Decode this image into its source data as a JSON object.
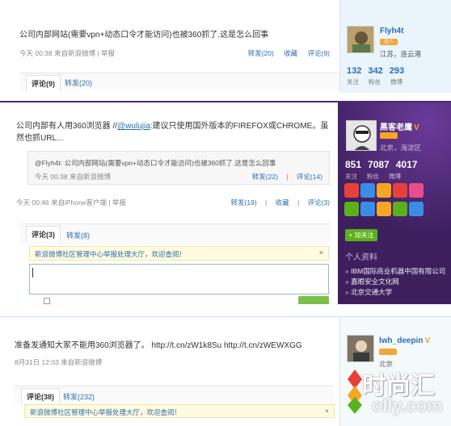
{
  "post1": {
    "text": "公司内部网站(需要vpn+动态口令才能访问)也被360抓了.这是怎么回事",
    "meta_left": "今天 00:38 来自新浪微博 | 举报",
    "actions": [
      "转发(20)",
      "收藏",
      "评论(9)"
    ],
    "tabs": [
      "评论(9)",
      "转发(20)"
    ],
    "user": {
      "name": "Flyh4t",
      "level": "达人",
      "location": "江苏，连云港",
      "stats": [
        "132",
        "342",
        "293"
      ],
      "stat_labels": [
        "关注",
        "粉丝",
        "微博"
      ]
    }
  },
  "post2": {
    "text_before": "公司内部有人用360浏览器 //",
    "mention": "@wulujia",
    "text_after": ":建议只使用国外版本的FIREFOX或CHROME。虽然也抓URL...",
    "quote": {
      "text": "@Flyh4t:  公司内部网站(需要vpn+动态口令才能访问)也被360抓了.这是怎么回事",
      "meta_left": "今天 00:38    来自新浪微博",
      "actions": [
        "转发(22)",
        "|",
        "评论(14)"
      ]
    },
    "meta_left": "今天 00:46 来自iPhone客户端 | 举报",
    "actions": [
      "转发(19)",
      "|",
      "收藏",
      "|",
      "评论(3)"
    ],
    "tabs": [
      "评论(3)",
      "转发(8)"
    ],
    "notice": "新浪微博社区管理中心举报处理大厅，欢迎查阅！",
    "close": "×",
    "user": {
      "name": "黑客老鹰",
      "verified": "V",
      "location": "北京，海淀区",
      "stats": [
        "851",
        "7087",
        "4017"
      ],
      "stat_labels": [
        "关注",
        "粉丝",
        "微博"
      ]
    },
    "follow_button": "+ 加关注",
    "side_heading": "个人资料",
    "side_list": [
      "IBM国际商业机器中国有限公司",
      "嘉眼安全文化网",
      "北京交通大学"
    ],
    "icon_colors": [
      "#e7403a",
      "#3a8de7",
      "#f5a623",
      "#e7403a",
      "#e74c8c",
      "#5ab11c",
      "#3a8de7",
      "#f5a623",
      "#5ab11c",
      "#3a8de7"
    ]
  },
  "post3": {
    "text": "准备发通知大家不能用360浏览器了。 http://t.cn/zW1k8Su http://t.cn/zWEWXGG",
    "meta_left": "8月31日 12:03 来自新浪微博",
    "tabs": [
      "评论(38)",
      "转发(232)"
    ],
    "notice": "新浪微博社区管理中心举报处理大厅，欢迎查阅！",
    "close": "×",
    "user": {
      "name": "lwh_deepin",
      "verified": "V",
      "location": "北京"
    }
  },
  "watermark": {
    "big": "时尚汇",
    "small": "olly.com"
  }
}
